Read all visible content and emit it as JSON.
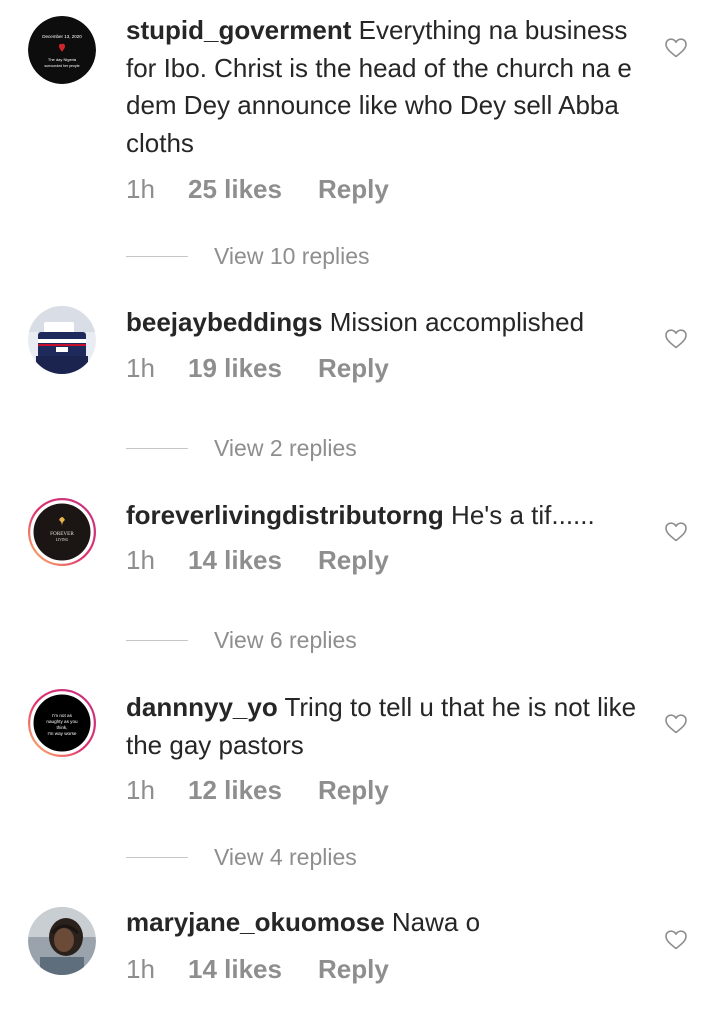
{
  "comments": [
    {
      "username": "stupid_goverment",
      "text": "Everything na business for Ibo. Christ is the head of the church na e dem Dey announce like who Dey sell Abba cloths",
      "time": "1h",
      "likes": "25 likes",
      "reply": "Reply",
      "view_replies": "View 10 replies",
      "avatar_text": [
        "December 13, 2020",
        "The day Nigeria",
        "surrounded her people"
      ]
    },
    {
      "username": "beejaybeddings",
      "text": "Mission accomplished",
      "time": "1h",
      "likes": "19 likes",
      "reply": "Reply",
      "view_replies": "View 2 replies"
    },
    {
      "username": "foreverlivingdistributorng",
      "text": "He's a tif......",
      "time": "1h",
      "likes": "14 likes",
      "reply": "Reply",
      "view_replies": "View 6 replies",
      "avatar_text": [
        "FOREVER",
        "LIVING"
      ]
    },
    {
      "username": "dannnyy_yo",
      "text": "Tring to tell u that he is not like the gay pastors",
      "time": "1h",
      "likes": "12 likes",
      "reply": "Reply",
      "view_replies": "View 4 replies",
      "avatar_text": [
        "I'm not as",
        "naughty as you",
        "think,",
        "I'm way worse"
      ]
    },
    {
      "username": "maryjane_okuomose",
      "text": "Nawa o",
      "time": "1h",
      "likes": "14 likes",
      "reply": "Reply"
    }
  ],
  "colors": {
    "text": "#262626",
    "muted": "#8e8e8e",
    "story_ring_start": "#c13584",
    "story_ring_end": "#fdc468"
  },
  "icons": {
    "like": "heart-outline-icon"
  }
}
